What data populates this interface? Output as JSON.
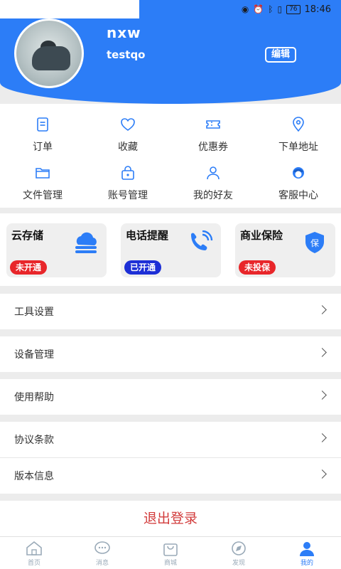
{
  "status_bar": {
    "time": "18:46",
    "battery": "76"
  },
  "profile": {
    "username": "nxw",
    "user_id": "testqo",
    "edit_label": "编辑"
  },
  "grid": [
    {
      "label": "订单",
      "icon": "order-icon"
    },
    {
      "label": "收藏",
      "icon": "heart-icon"
    },
    {
      "label": "优惠券",
      "icon": "coupon-icon"
    },
    {
      "label": "下单地址",
      "icon": "location-icon"
    },
    {
      "label": "文件管理",
      "icon": "folder-icon"
    },
    {
      "label": "账号管理",
      "icon": "lock-bag-icon"
    },
    {
      "label": "我的好友",
      "icon": "person-icon"
    },
    {
      "label": "客服中心",
      "icon": "customer-service-icon"
    }
  ],
  "cards": [
    {
      "title": "云存储",
      "badge": "未开通",
      "badge_color": "#e8262a",
      "icon": "cloud-storage-icon"
    },
    {
      "title": "电话提醒",
      "badge": "已开通",
      "badge_color": "#1d2fd6",
      "icon": "phone-icon"
    },
    {
      "title": "商业保险",
      "badge": "未投保",
      "badge_color": "#e8262a",
      "icon": "shield-icon",
      "icon_text": "保"
    }
  ],
  "menu": [
    {
      "label": "工具设置"
    },
    {
      "label": "设备管理"
    },
    {
      "label": "使用帮助"
    },
    {
      "label": "协议条款"
    },
    {
      "label": "版本信息"
    }
  ],
  "logout_label": "退出登录",
  "bottom_nav": [
    {
      "label": "首页",
      "icon": "home-icon"
    },
    {
      "label": "消息",
      "icon": "message-icon"
    },
    {
      "label": "商城",
      "icon": "shop-bag-icon"
    },
    {
      "label": "发现",
      "icon": "discover-icon"
    },
    {
      "label": "我的",
      "icon": "profile-icon",
      "active": true
    }
  ],
  "colors": {
    "primary": "#2c7df7",
    "danger": "#d23c3c",
    "badge_red": "#e8262a",
    "badge_blue": "#1d2fd6"
  }
}
